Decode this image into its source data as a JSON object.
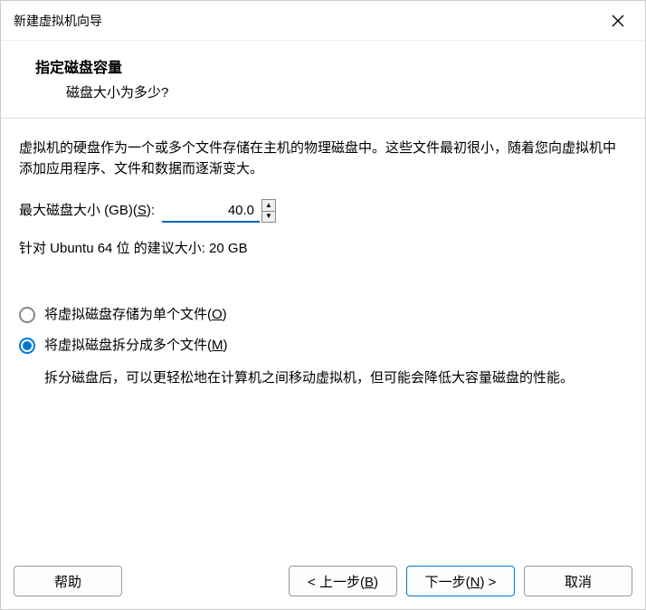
{
  "window": {
    "title": "新建虚拟机向导"
  },
  "header": {
    "title": "指定磁盘容量",
    "subtitle": "磁盘大小为多少?"
  },
  "content": {
    "description": "虚拟机的硬盘作为一个或多个文件存储在主机的物理磁盘中。这些文件最初很小，随着您向虚拟机中添加应用程序、文件和数据而逐渐变大。",
    "disk_size_label_prefix": "最大磁盘大小 (GB)(",
    "disk_size_hotkey": "S",
    "disk_size_label_suffix": "):",
    "disk_size_value": "40.0",
    "recommend_text": "针对 Ubuntu 64 位 的建议大小: 20 GB",
    "radio_single_prefix": "将虚拟磁盘存储为单个文件(",
    "radio_single_hotkey": "O",
    "radio_single_suffix": ")",
    "radio_split_prefix": "将虚拟磁盘拆分成多个文件(",
    "radio_split_hotkey": "M",
    "radio_split_suffix": ")",
    "split_desc": "拆分磁盘后，可以更轻松地在计算机之间移动虚拟机，但可能会降低大容量磁盘的性能。"
  },
  "footer": {
    "help": "帮助",
    "back_prefix": "< 上一步(",
    "back_hotkey": "B",
    "back_suffix": ")",
    "next_prefix": "下一步(",
    "next_hotkey": "N",
    "next_suffix": ") >",
    "cancel": "取消"
  }
}
